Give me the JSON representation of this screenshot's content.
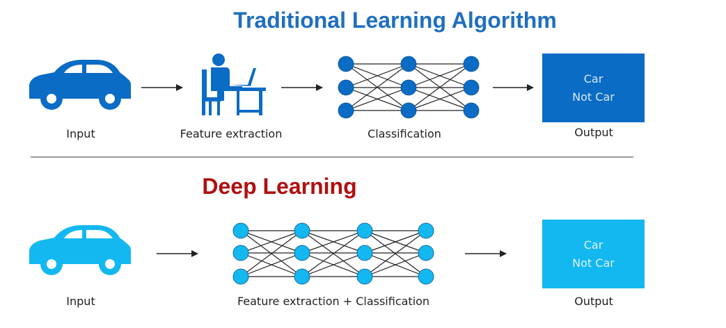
{
  "colors": {
    "title_traditional": "#1f6fbf",
    "title_deep": "#b01010",
    "traditional_blue": "#0a6cc4",
    "deep_blue": "#13b8f0",
    "edge": "#222222"
  },
  "traditional": {
    "title": "Traditional Learning Algorithm",
    "steps": {
      "input_label": "Input",
      "feature_label": "Feature extraction",
      "classification_label": "Classification",
      "output_label": "Output"
    },
    "output": {
      "line1": "Car",
      "line2": "Not Car"
    },
    "icons": [
      "car-icon",
      "person-at-computer-icon",
      "neural-network-icon"
    ]
  },
  "deep": {
    "title": "Deep Learning",
    "steps": {
      "input_label": "Input",
      "network_label": "Feature extraction + Classification",
      "output_label": "Output"
    },
    "output": {
      "line1": "Car",
      "line2": "Not Car"
    },
    "icons": [
      "car-icon",
      "neural-network-icon"
    ]
  }
}
